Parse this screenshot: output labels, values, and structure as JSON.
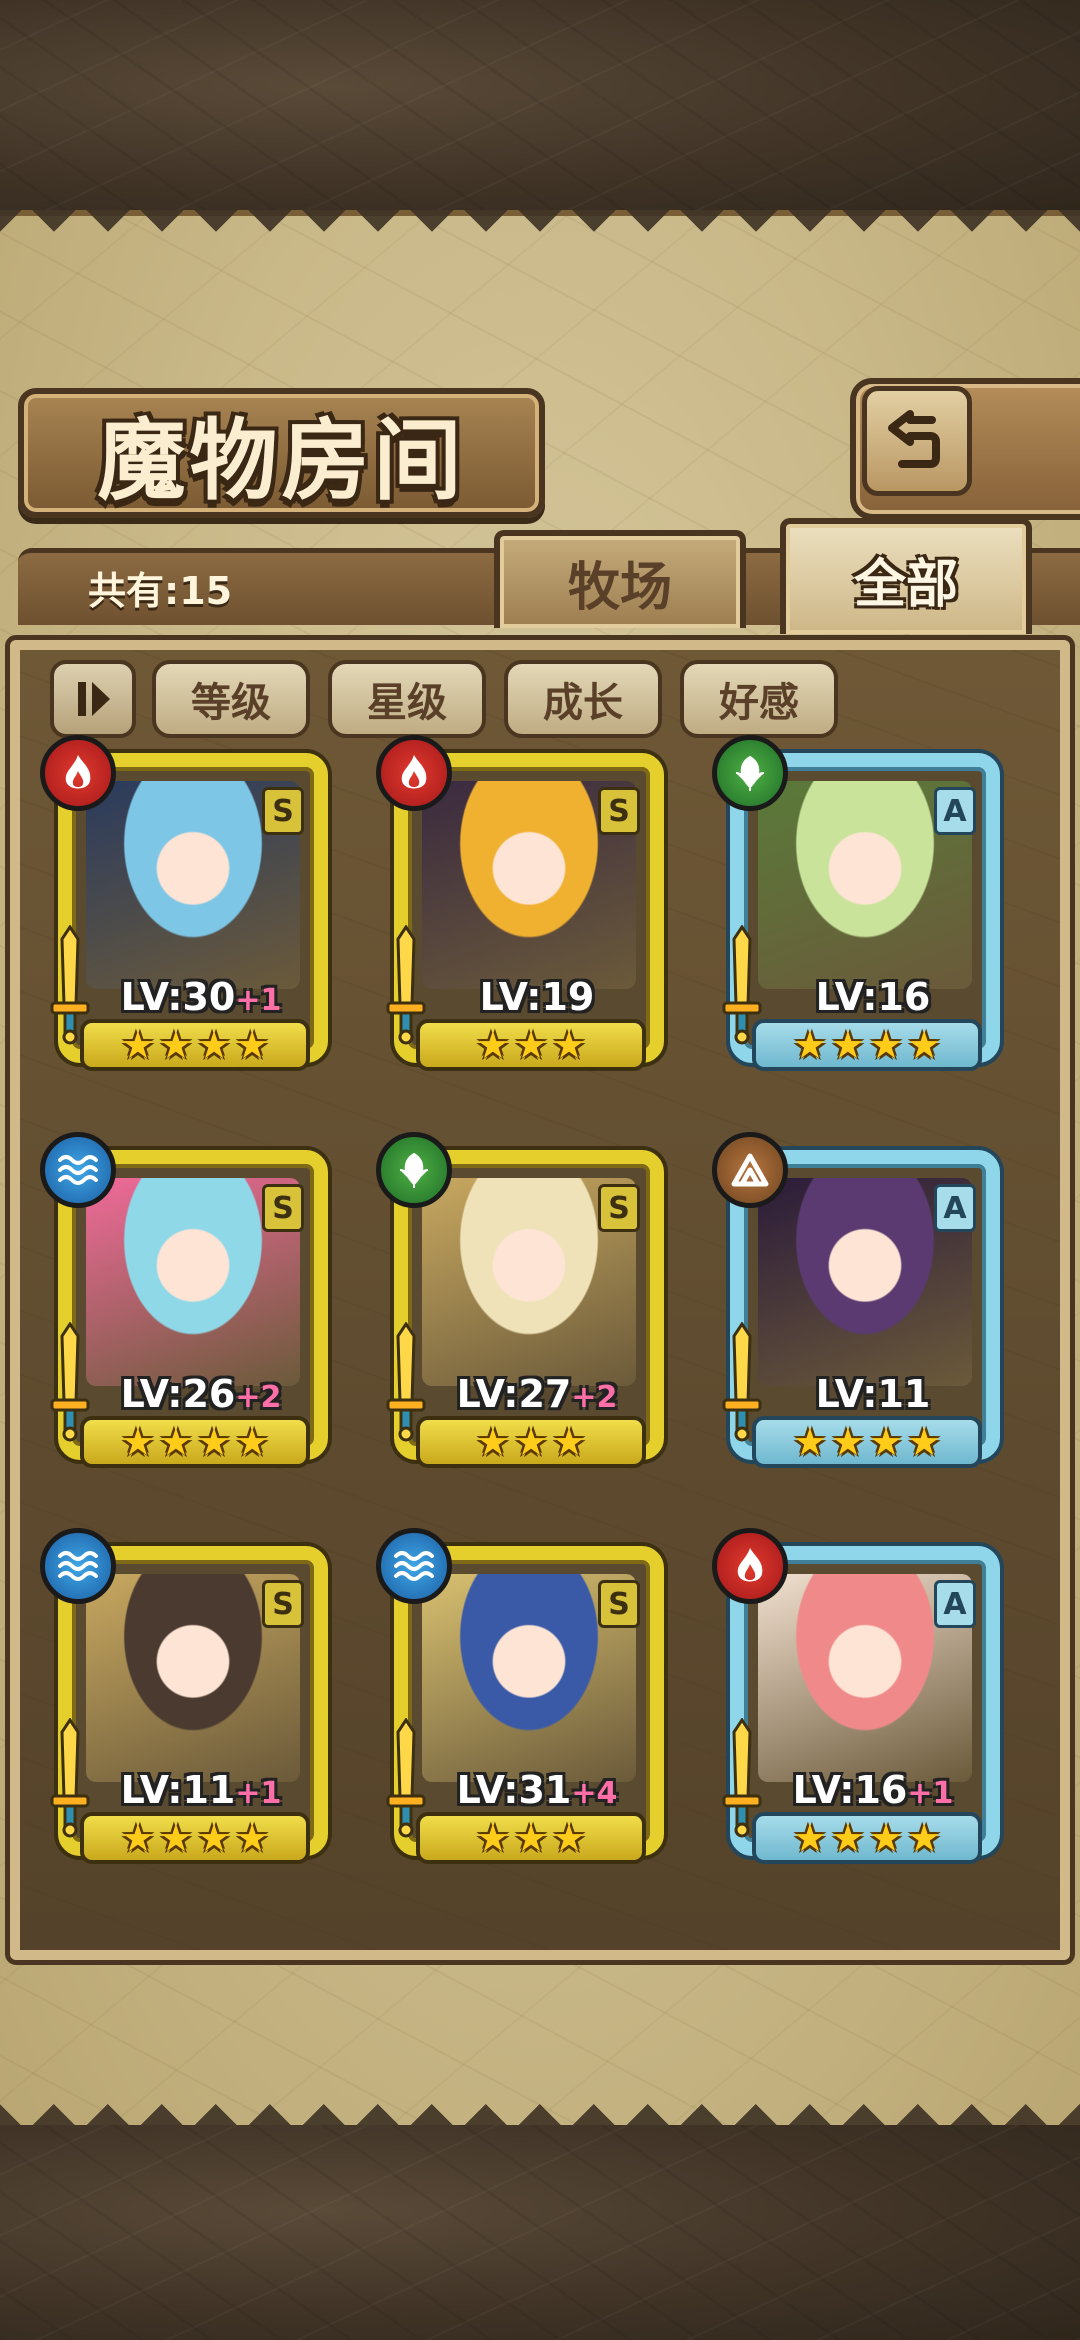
{
  "header": {
    "title": "魔物房间",
    "back_icon": "back-arrow-icon"
  },
  "tabs": {
    "count_label": "共有:15",
    "pasture": "牧场",
    "all": "全部"
  },
  "sort": {
    "toggle_icon": "sort-toggle-icon",
    "buttons": [
      "等级",
      "星级",
      "成长",
      "好感"
    ]
  },
  "colors": {
    "fire": "#d1281f",
    "water": "#2f86cf",
    "wood": "#3a9a37",
    "earth": "#93582b",
    "rank_S_frame": "#e5cf2c",
    "rank_A_frame": "#8fd6ea"
  },
  "monsters": [
    {
      "element": "fire",
      "rank": "S",
      "level": "LV:30",
      "plus": "+1",
      "stars": 4
    },
    {
      "element": "fire",
      "rank": "S",
      "level": "LV:19",
      "plus": "",
      "stars": 3
    },
    {
      "element": "wood",
      "rank": "A",
      "level": "LV:16",
      "plus": "",
      "stars": 4
    },
    {
      "element": "water",
      "rank": "S",
      "level": "LV:26",
      "plus": "+2",
      "stars": 4
    },
    {
      "element": "wood",
      "rank": "S",
      "level": "LV:27",
      "plus": "+2",
      "stars": 3
    },
    {
      "element": "earth",
      "rank": "A",
      "level": "LV:11",
      "plus": "",
      "stars": 4
    },
    {
      "element": "water",
      "rank": "S",
      "level": "LV:11",
      "plus": "+1",
      "stars": 4
    },
    {
      "element": "water",
      "rank": "S",
      "level": "LV:31",
      "plus": "+4",
      "stars": 3
    },
    {
      "element": "fire",
      "rank": "A",
      "level": "LV:16",
      "plus": "+1",
      "stars": 4
    }
  ]
}
